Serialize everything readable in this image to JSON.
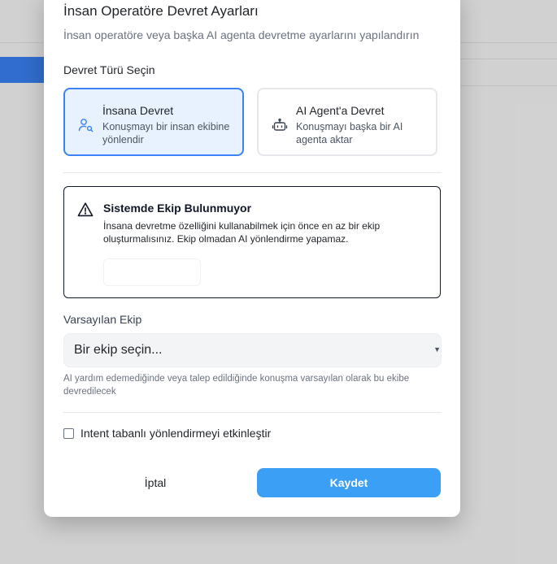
{
  "dialog": {
    "title": "İnsan Operatöre Devret Ayarları",
    "subtitle": "İnsan operatöre veya başka AI agenta devretme ayarlarını yapılandırın"
  },
  "handoff_type": {
    "label": "Devret Türü Seçin",
    "options": [
      {
        "title": "İnsana Devret",
        "description": "Konuşmayı bir insan ekibine yönlendir",
        "icon": "user-search-icon",
        "selected": true
      },
      {
        "title": "AI Agent'a Devret",
        "description": "Konuşmayı başka bir AI agenta aktar",
        "icon": "robot-icon",
        "selected": false
      }
    ]
  },
  "warning": {
    "icon": "warning-triangle-icon",
    "title": "Sistemde Ekip Bulunmuyor",
    "message": "İnsana devretme özelliğini kullanabilmek için önce en az bir ekip oluşturmalısınız. Ekip olmadan AI yönlendirme yapamaz."
  },
  "default_team": {
    "label": "Varsayılan Ekip",
    "selected_value": "Bir ekip seçin...",
    "hint": "AI yardım edemediğinde veya talep edildiğinde konuşma varsayılan olarak bu ekibe devredilecek"
  },
  "intent_routing": {
    "label": "Intent tabanlı yönlendirmeyi etkinleştir",
    "checked": false
  },
  "actions": {
    "cancel_label": "İptal",
    "save_label": "Kaydet"
  },
  "colors": {
    "accent": "#3b82f6",
    "selected_bg": "#e8f2ff",
    "save_button": "#3b9ff5"
  }
}
